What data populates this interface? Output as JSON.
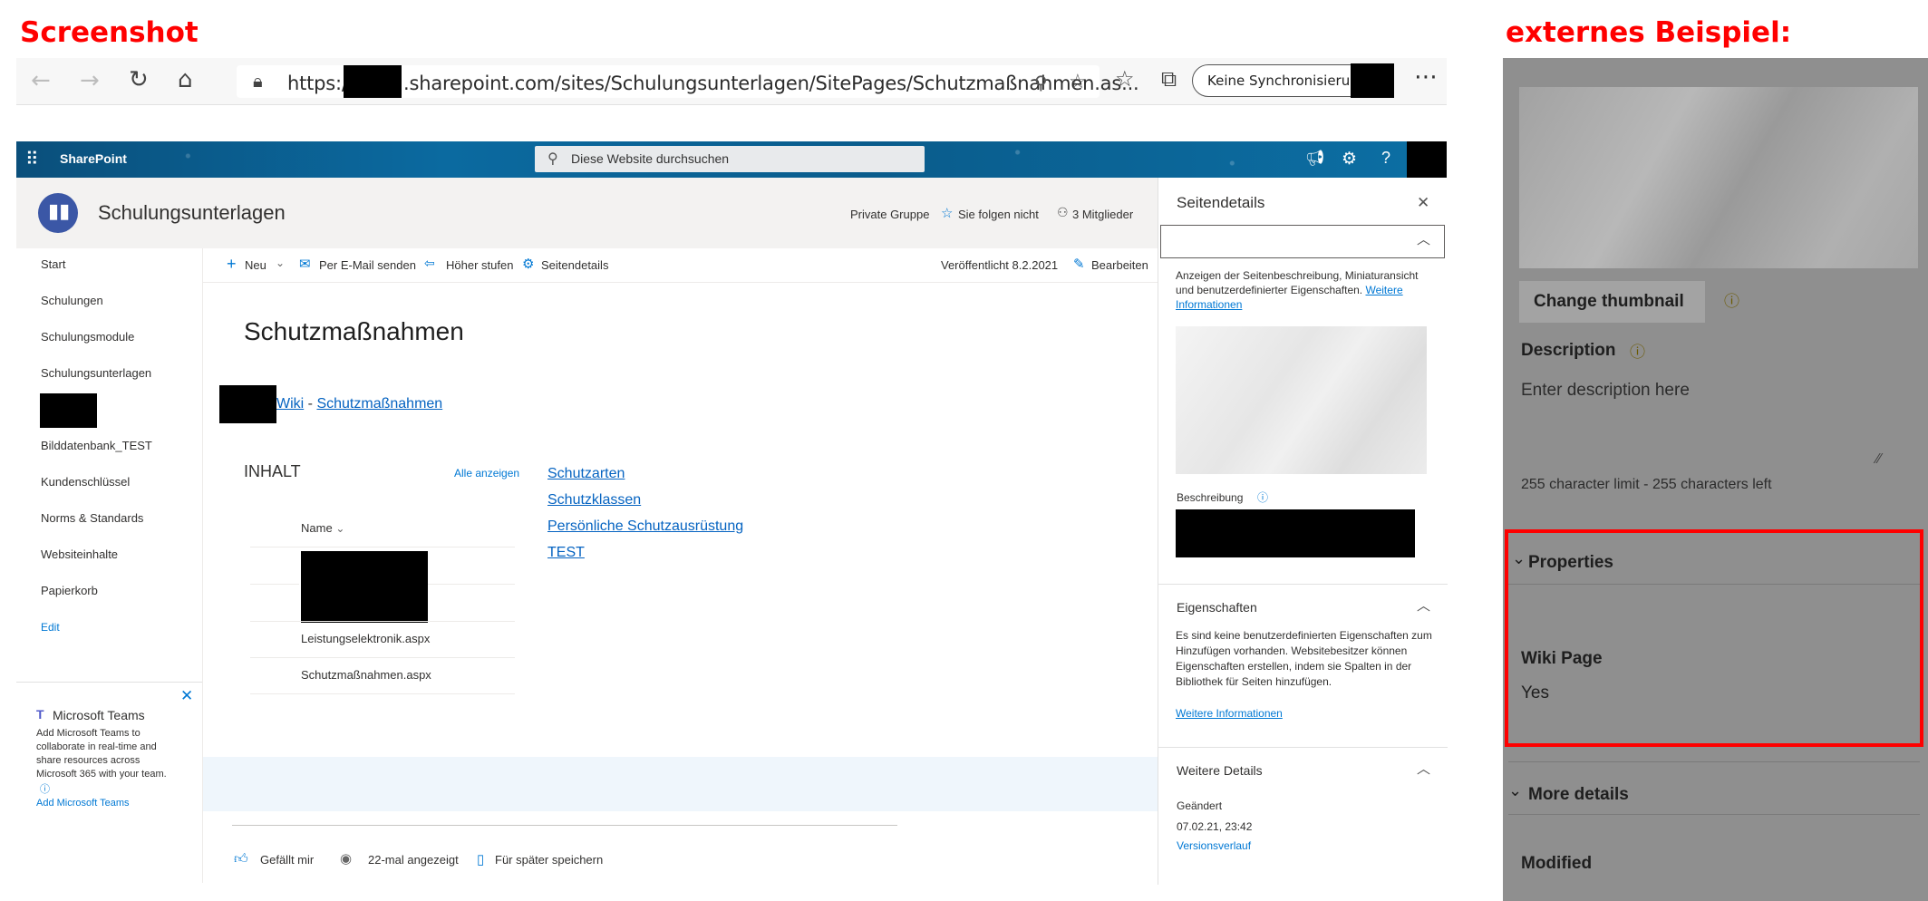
{
  "labels": {
    "screenshot": "Screenshot",
    "external": "externes Beispiel:"
  },
  "browser": {
    "url_prefix": "https://",
    "url_rest": ".sharepoint.com/sites/Schulungsunterlagen/SitePages/Schutzmaßnahmen.as...",
    "sync_button": "Keine Synchronisierung",
    "icons": [
      "back-icon",
      "forward-icon",
      "refresh-icon",
      "home-icon",
      "lock-icon",
      "zoom-icon",
      "favorite-add-icon",
      "favorites-icon",
      "collections-icon",
      "more-icon"
    ]
  },
  "suite": {
    "app_name": "SharePoint",
    "search_placeholder": "Diese Website durchsuchen"
  },
  "site": {
    "title": "Schulungsunterlagen",
    "group_type": "Private Gruppe",
    "follow": "Sie folgen nicht",
    "members": "3 Mitglieder"
  },
  "leftnav": {
    "items": [
      "Start",
      "Schulungen",
      "Schulungsmodule",
      "Schulungsunterlagen",
      "Bilddatenbank_TEST",
      "Kundenschlüssel",
      "Norms & Standards",
      "Websiteinhalte",
      "Papierkorb"
    ],
    "edit": "Edit"
  },
  "teams_promo": {
    "title": "Microsoft Teams",
    "body": "Add Microsoft Teams to collaborate in real-time and share resources across Microsoft 365 with your team.",
    "link": "Add Microsoft Teams"
  },
  "commandbar": {
    "new": "Neu",
    "email": "Per E-Mail senden",
    "promote": "Höher stufen",
    "details": "Seitendetails",
    "published": "Veröffentlicht 8.2.2021",
    "edit": "Bearbeiten"
  },
  "page": {
    "title": "Schutzmaßnahmen",
    "breadcrumb_wiki": "Wiki",
    "breadcrumb_sep": "-",
    "breadcrumb_page": "Schutzmaßnahmen",
    "content_heading": "INHALT",
    "show_all": "Alle anzeigen",
    "column_name": "Name",
    "files": [
      "Leistungselektronik.aspx",
      "Schutzmaßnahmen.aspx"
    ],
    "links": [
      "Schutzarten",
      "Schutzklassen",
      "Persönliche Schutzausrüstung",
      "TEST"
    ],
    "footer": {
      "like": "Gefällt mir",
      "views": "22-mal angezeigt",
      "save": "Für später speichern"
    }
  },
  "panel": {
    "title": "Seitendetails",
    "intro": "Anzeigen der Seitenbeschreibung, Miniaturansicht und benutzerdefinierter Eigenschaften.",
    "intro_link": "Weitere Informationen",
    "description_label": "Beschreibung",
    "properties_heading": "Eigenschaften",
    "properties_text": "Es sind keine benutzerdefinierten Eigenschaften zum Hinzufügen vorhanden. Websitebesitzer können Eigenschaften erstellen, indem sie Spalten in der Bibliothek für Seiten hinzufügen.",
    "properties_link": "Weitere Informationen",
    "more_heading": "Weitere Details",
    "modified_label": "Geändert",
    "modified_value": "07.02.21, 23:42",
    "version_link": "Versionsverlauf"
  },
  "external": {
    "change_thumbnail": "Change thumbnail",
    "description_label": "Description",
    "description_placeholder": "Enter description here",
    "char_limit": "255 character limit - 255 characters left",
    "properties_heading": "Properties",
    "wiki_page_label": "Wiki Page",
    "wiki_page_value": "Yes",
    "more_details": "More details",
    "modified_label": "Modified"
  }
}
